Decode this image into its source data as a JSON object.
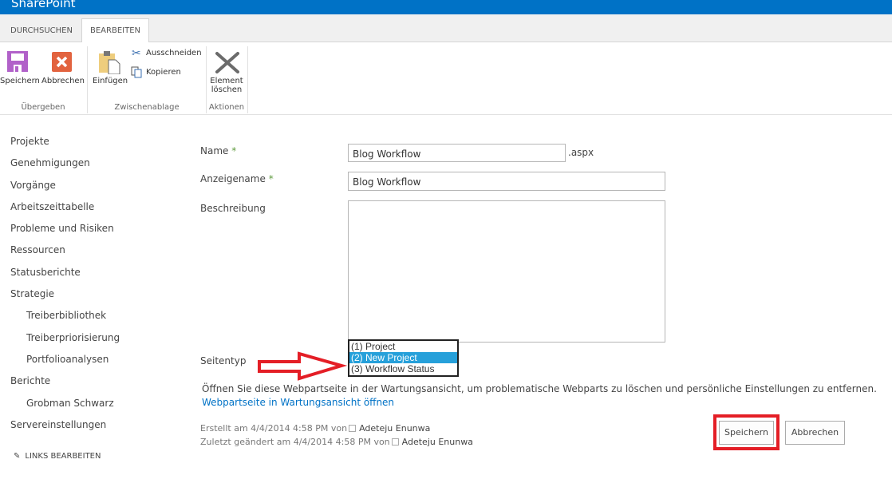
{
  "app": {
    "title": "SharePoint",
    "accent": "#0072c6"
  },
  "ribbon": {
    "tabs": [
      {
        "label": "DURCHSUCHEN"
      },
      {
        "label": "BEARBEITEN",
        "active": true
      }
    ],
    "groups": [
      {
        "label": "Übergeben",
        "buttons": [
          {
            "label": "Speichern",
            "icon": "save-icon"
          },
          {
            "label": "Abbrechen",
            "icon": "cancel-icon"
          }
        ]
      },
      {
        "label": "Zwischenablage",
        "buttons": [
          {
            "label": "Einfügen",
            "icon": "paste-icon"
          },
          {
            "label": "Ausschneiden",
            "icon": "cut-icon"
          },
          {
            "label": "Kopieren",
            "icon": "copy-icon"
          }
        ]
      },
      {
        "label": "Aktionen",
        "buttons": [
          {
            "label_line1": "Element",
            "label_line2": "löschen",
            "icon": "delete-icon"
          }
        ]
      }
    ]
  },
  "nav": {
    "items": [
      {
        "label": "Projekte"
      },
      {
        "label": "Genehmigungen"
      },
      {
        "label": "Vorgänge"
      },
      {
        "label": "Arbeitszeittabelle"
      },
      {
        "label": "Probleme und Risiken"
      },
      {
        "label": "Ressourcen"
      },
      {
        "label": "Statusberichte"
      },
      {
        "label": "Strategie"
      },
      {
        "label": "Treiberbibliothek"
      },
      {
        "label": "Treiberpriorisierung"
      },
      {
        "label": "Portfolioanalysen"
      },
      {
        "label": "Berichte"
      },
      {
        "label": "Grobman Schwarz"
      },
      {
        "label": "Servereinstellungen"
      }
    ],
    "edit_links": "LINKS BEARBEITEN"
  },
  "form": {
    "name_label": "Name",
    "required_mark": "*",
    "name_value": "Blog Workflow",
    "name_suffix": ".aspx",
    "display_label": "Anzeigename",
    "display_value": "Blog Workflow",
    "desc_label": "Beschreibung",
    "desc_value": "",
    "pagetype_label": "Seitentyp",
    "pagetype_options": [
      "(1) Project",
      "(2) New Project",
      "(3) Workflow Status"
    ],
    "pagetype_selected": "(2) New Project",
    "maintenance_text": "Öffnen Sie diese Webpartseite in der Wartungsansicht, um problematische Webparts zu löschen und persönliche Einstellungen zu entfernen.",
    "maintenance_link": "Webpartseite in Wartungsansicht öffnen",
    "created_text": "Erstellt am 4/4/2014 4:58 PM  von",
    "created_by": "Adeteju Enunwa",
    "modified_text": "Zuletzt geändert am 4/4/2014 4:58 PM  von",
    "modified_by": "Adeteju Enunwa",
    "save": "Speichern",
    "cancel": "Abbrechen"
  },
  "annotation_color": "#e41e26"
}
